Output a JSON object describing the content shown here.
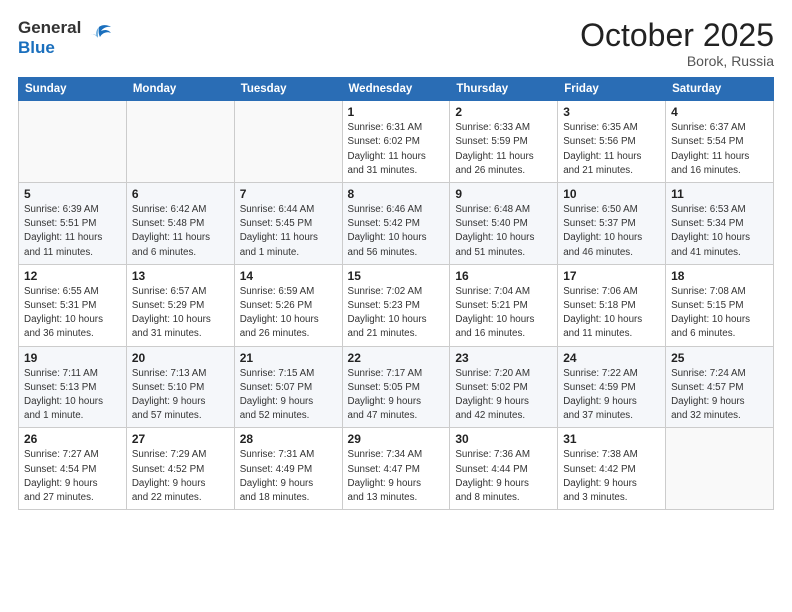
{
  "header": {
    "logo_general": "General",
    "logo_blue": "Blue",
    "month_title": "October 2025",
    "location": "Borok, Russia"
  },
  "days_of_week": [
    "Sunday",
    "Monday",
    "Tuesday",
    "Wednesday",
    "Thursday",
    "Friday",
    "Saturday"
  ],
  "weeks": [
    [
      {
        "day": "",
        "info": ""
      },
      {
        "day": "",
        "info": ""
      },
      {
        "day": "",
        "info": ""
      },
      {
        "day": "1",
        "info": "Sunrise: 6:31 AM\nSunset: 6:02 PM\nDaylight: 11 hours\nand 31 minutes."
      },
      {
        "day": "2",
        "info": "Sunrise: 6:33 AM\nSunset: 5:59 PM\nDaylight: 11 hours\nand 26 minutes."
      },
      {
        "day": "3",
        "info": "Sunrise: 6:35 AM\nSunset: 5:56 PM\nDaylight: 11 hours\nand 21 minutes."
      },
      {
        "day": "4",
        "info": "Sunrise: 6:37 AM\nSunset: 5:54 PM\nDaylight: 11 hours\nand 16 minutes."
      }
    ],
    [
      {
        "day": "5",
        "info": "Sunrise: 6:39 AM\nSunset: 5:51 PM\nDaylight: 11 hours\nand 11 minutes."
      },
      {
        "day": "6",
        "info": "Sunrise: 6:42 AM\nSunset: 5:48 PM\nDaylight: 11 hours\nand 6 minutes."
      },
      {
        "day": "7",
        "info": "Sunrise: 6:44 AM\nSunset: 5:45 PM\nDaylight: 11 hours\nand 1 minute."
      },
      {
        "day": "8",
        "info": "Sunrise: 6:46 AM\nSunset: 5:42 PM\nDaylight: 10 hours\nand 56 minutes."
      },
      {
        "day": "9",
        "info": "Sunrise: 6:48 AM\nSunset: 5:40 PM\nDaylight: 10 hours\nand 51 minutes."
      },
      {
        "day": "10",
        "info": "Sunrise: 6:50 AM\nSunset: 5:37 PM\nDaylight: 10 hours\nand 46 minutes."
      },
      {
        "day": "11",
        "info": "Sunrise: 6:53 AM\nSunset: 5:34 PM\nDaylight: 10 hours\nand 41 minutes."
      }
    ],
    [
      {
        "day": "12",
        "info": "Sunrise: 6:55 AM\nSunset: 5:31 PM\nDaylight: 10 hours\nand 36 minutes."
      },
      {
        "day": "13",
        "info": "Sunrise: 6:57 AM\nSunset: 5:29 PM\nDaylight: 10 hours\nand 31 minutes."
      },
      {
        "day": "14",
        "info": "Sunrise: 6:59 AM\nSunset: 5:26 PM\nDaylight: 10 hours\nand 26 minutes."
      },
      {
        "day": "15",
        "info": "Sunrise: 7:02 AM\nSunset: 5:23 PM\nDaylight: 10 hours\nand 21 minutes."
      },
      {
        "day": "16",
        "info": "Sunrise: 7:04 AM\nSunset: 5:21 PM\nDaylight: 10 hours\nand 16 minutes."
      },
      {
        "day": "17",
        "info": "Sunrise: 7:06 AM\nSunset: 5:18 PM\nDaylight: 10 hours\nand 11 minutes."
      },
      {
        "day": "18",
        "info": "Sunrise: 7:08 AM\nSunset: 5:15 PM\nDaylight: 10 hours\nand 6 minutes."
      }
    ],
    [
      {
        "day": "19",
        "info": "Sunrise: 7:11 AM\nSunset: 5:13 PM\nDaylight: 10 hours\nand 1 minute."
      },
      {
        "day": "20",
        "info": "Sunrise: 7:13 AM\nSunset: 5:10 PM\nDaylight: 9 hours\nand 57 minutes."
      },
      {
        "day": "21",
        "info": "Sunrise: 7:15 AM\nSunset: 5:07 PM\nDaylight: 9 hours\nand 52 minutes."
      },
      {
        "day": "22",
        "info": "Sunrise: 7:17 AM\nSunset: 5:05 PM\nDaylight: 9 hours\nand 47 minutes."
      },
      {
        "day": "23",
        "info": "Sunrise: 7:20 AM\nSunset: 5:02 PM\nDaylight: 9 hours\nand 42 minutes."
      },
      {
        "day": "24",
        "info": "Sunrise: 7:22 AM\nSunset: 4:59 PM\nDaylight: 9 hours\nand 37 minutes."
      },
      {
        "day": "25",
        "info": "Sunrise: 7:24 AM\nSunset: 4:57 PM\nDaylight: 9 hours\nand 32 minutes."
      }
    ],
    [
      {
        "day": "26",
        "info": "Sunrise: 7:27 AM\nSunset: 4:54 PM\nDaylight: 9 hours\nand 27 minutes."
      },
      {
        "day": "27",
        "info": "Sunrise: 7:29 AM\nSunset: 4:52 PM\nDaylight: 9 hours\nand 22 minutes."
      },
      {
        "day": "28",
        "info": "Sunrise: 7:31 AM\nSunset: 4:49 PM\nDaylight: 9 hours\nand 18 minutes."
      },
      {
        "day": "29",
        "info": "Sunrise: 7:34 AM\nSunset: 4:47 PM\nDaylight: 9 hours\nand 13 minutes."
      },
      {
        "day": "30",
        "info": "Sunrise: 7:36 AM\nSunset: 4:44 PM\nDaylight: 9 hours\nand 8 minutes."
      },
      {
        "day": "31",
        "info": "Sunrise: 7:38 AM\nSunset: 4:42 PM\nDaylight: 9 hours\nand 3 minutes."
      },
      {
        "day": "",
        "info": ""
      }
    ]
  ]
}
